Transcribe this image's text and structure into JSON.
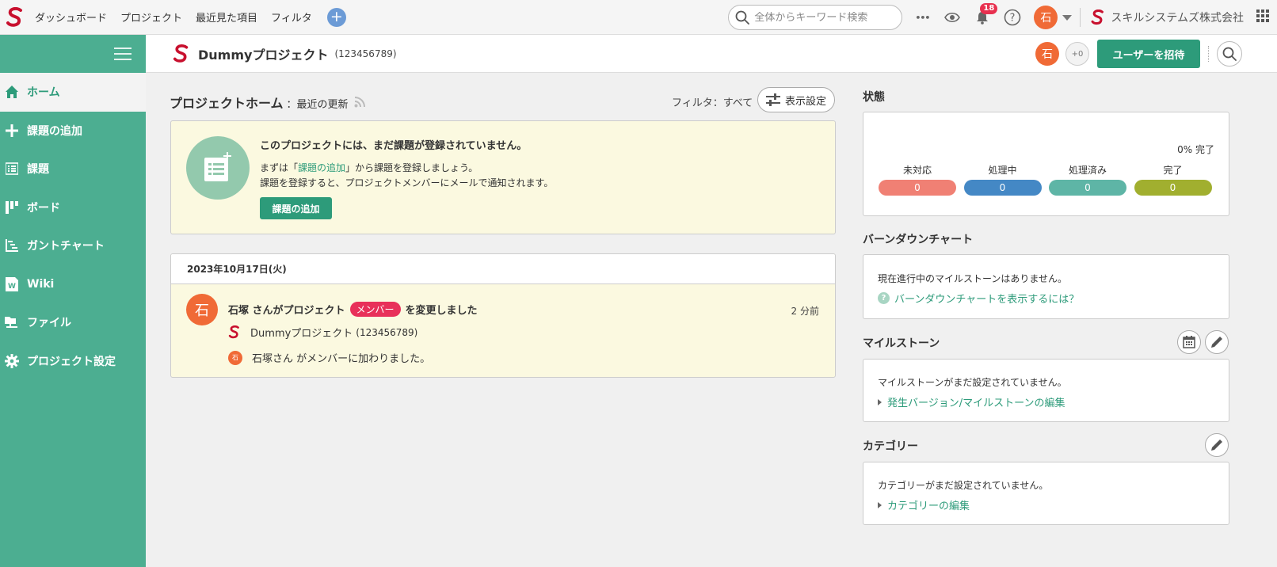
{
  "topnav": {
    "items": [
      "ダッシュボード",
      "プロジェクト",
      "最近見た項目",
      "フィルタ"
    ],
    "add_symbol": "+"
  },
  "topbar": {
    "search_placeholder": "全体からキーワード検索",
    "more_symbol": "•••",
    "notification_count": "18",
    "user_avatar": "石",
    "company_name": "スキルシステムズ株式会社"
  },
  "sidebar": {
    "items": [
      {
        "label": "ホーム",
        "icon": "home-icon",
        "active": true
      },
      {
        "label": "課題の追加",
        "icon": "plus-icon"
      },
      {
        "label": "課題",
        "icon": "list-icon"
      },
      {
        "label": "ボード",
        "icon": "board-icon"
      },
      {
        "label": "ガントチャート",
        "icon": "gantt-icon"
      },
      {
        "label": "Wiki",
        "icon": "wiki-icon"
      },
      {
        "label": "ファイル",
        "icon": "folder-icon"
      },
      {
        "label": "プロジェクト設定",
        "icon": "gear-icon"
      }
    ]
  },
  "project": {
    "name": "Dummyプロジェクト",
    "key": "(123456789)",
    "member_avatar": "石",
    "extra_members": "+0",
    "invite_label": "ユーザーを招待"
  },
  "main": {
    "title": "プロジェクトホーム",
    "subtitle": "：最近の更新",
    "filter_label": "フィルタ：すべて",
    "display_settings_label": "表示設定",
    "notice": {
      "title": "このプロジェクトには、まだ課題が登録されていません。",
      "line1_prefix": "まずは「",
      "line1_link": "課題の追加",
      "line1_suffix": "」から課題を登録しましょう。",
      "line2": "課題を登録すると、プロジェクトメンバーにメールで通知されます。",
      "button_label": "課題の追加"
    },
    "activity": {
      "date": "2023年10月17日(火)",
      "avatar": "石",
      "actor": "石塚 さんがプロジェクト",
      "badge": "メンバー",
      "action": "を変更しました",
      "time": "2 分前",
      "project_name": "Dummyプロジェクト",
      "project_key": "(123456789)",
      "mini_avatar": "石",
      "detail": "石塚さん がメンバーに加わりました。"
    }
  },
  "status": {
    "heading": "状態",
    "completion": "0% 完了",
    "columns": [
      {
        "label": "未対応",
        "count": "0",
        "color": "#f08074"
      },
      {
        "label": "処理中",
        "count": "0",
        "color": "#4488c5"
      },
      {
        "label": "処理済み",
        "count": "0",
        "color": "#5eb5a6"
      },
      {
        "label": "完了",
        "count": "0",
        "color": "#a1af2f"
      }
    ]
  },
  "burndown": {
    "heading": "バーンダウンチャート",
    "message": "現在進行中のマイルストーンはありません。",
    "help_link": "バーンダウンチャートを表示するには？"
  },
  "milestone": {
    "heading": "マイルストーン",
    "message": "マイルストーンがまだ設定されていません。",
    "edit_link": "発生バージョン/マイルストーンの編集"
  },
  "category": {
    "heading": "カテゴリー",
    "message": "カテゴリーがまだ設定されていません。",
    "edit_link": "カテゴリーの編集"
  }
}
